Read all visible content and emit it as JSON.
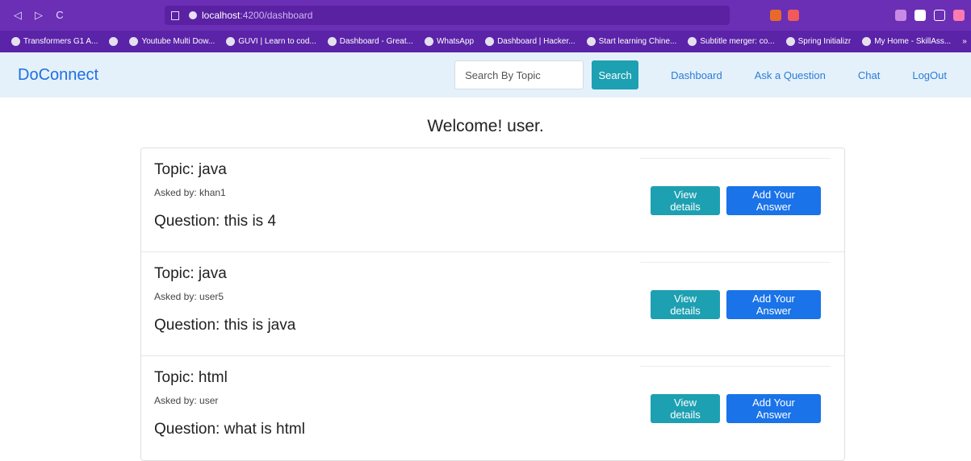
{
  "browser": {
    "url_host": "localhost",
    "url_path": ":4200/dashboard",
    "bookmarks": [
      {
        "label": "Transformers G1 A...",
        "icon": "transformers-icon"
      },
      {
        "label": "",
        "icon": "globe-icon"
      },
      {
        "label": "Youtube Multi Dow...",
        "icon": "globe-icon"
      },
      {
        "label": "GUVI | Learn to cod...",
        "icon": "guvi-icon"
      },
      {
        "label": "Dashboard - Great...",
        "icon": "g-icon"
      },
      {
        "label": "WhatsApp",
        "icon": "whatsapp-icon"
      },
      {
        "label": "Dashboard | Hacker...",
        "icon": "globe-icon"
      },
      {
        "label": "Start learning Chine...",
        "icon": "bookmark-icon"
      },
      {
        "label": "Subtitle merger: co...",
        "icon": "st-icon"
      },
      {
        "label": "Spring Initializr",
        "icon": "spring-icon"
      },
      {
        "label": "My Home - SkillAss...",
        "icon": "skillassure-icon"
      }
    ],
    "bookmarks_more": "»"
  },
  "nav": {
    "brand": "DoConnect",
    "search_placeholder": "Search By Topic",
    "search_button": "Search",
    "links": [
      "Dashboard",
      "Ask a Question",
      "Chat",
      "LogOut"
    ]
  },
  "welcome": "Welcome! user.",
  "questions": [
    {
      "topic": "Topic: java",
      "asked_by": "Asked by: khan1",
      "question": "Question: this is 4"
    },
    {
      "topic": "Topic: java",
      "asked_by": "Asked by: user5",
      "question": "Question: this is java"
    },
    {
      "topic": "Topic: html",
      "asked_by": "Asked by: user",
      "question": "Question: what is html"
    }
  ],
  "actions": {
    "view_details": "View details",
    "add_answer": "Add Your Answer"
  },
  "colors": {
    "browser_purple": "#6a2fb4",
    "navbar_bg": "#e4f1fb",
    "teal_button": "#1da0b2",
    "blue_button": "#1a73e8",
    "brand_blue": "#1f6fe0"
  }
}
